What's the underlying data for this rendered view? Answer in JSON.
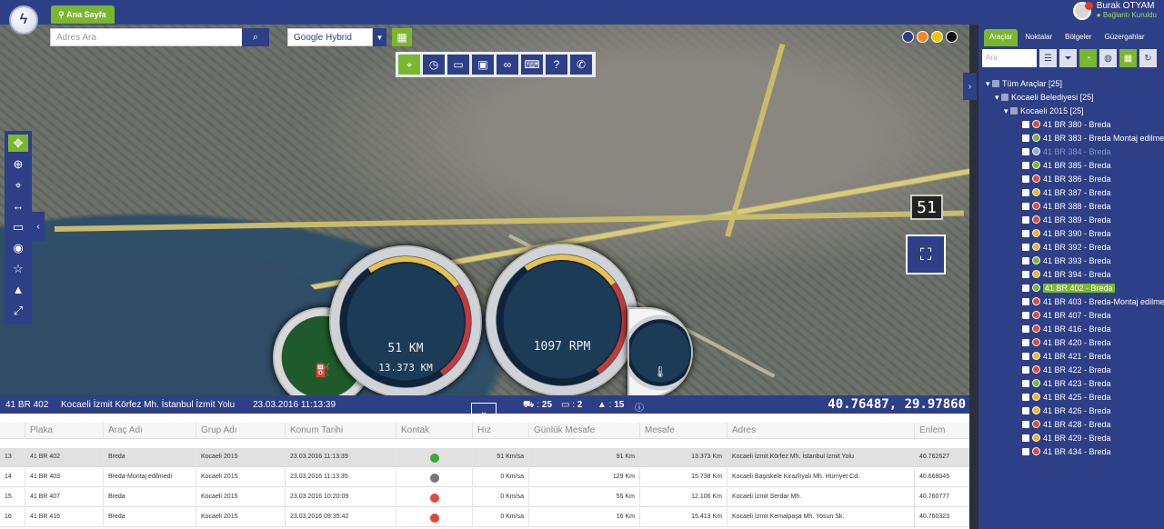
{
  "header": {
    "home_tab": "Ana Sayfa",
    "user_name": "Burak OTYAM",
    "user_status": "Bağlantı Kuruldu"
  },
  "map": {
    "search_placeholder": "Adres Ara",
    "map_type": "Google Hybrid",
    "color_dots": [
      "#2d3f86",
      "#f0882a",
      "#f2c300",
      "#111111"
    ],
    "speed_limit": "51",
    "gauges": {
      "speed_value": "51 KM",
      "odometer": "13.373 KM",
      "rpm_value": "1097 RPM"
    }
  },
  "status_bar": {
    "plate": "41 BR 402",
    "address": "Kocaeli İzmit Körfez Mh. İstanbul İzmit Yolu",
    "datetime": "23.03.2016 11:13:39",
    "vehicles": "25",
    "screens": "2",
    "roads": "15",
    "coordinates": "40.76487, 29.97860"
  },
  "table": {
    "headers": [
      "Plaka",
      "Araç Adı",
      "Grup Adı",
      "Konum Tarihi",
      "Kontak",
      "Hız",
      "Günlük Mesafe",
      "Mesafe",
      "Adres",
      "Enlem"
    ],
    "rows": [
      {
        "no": "13",
        "plate": "41 BR 402",
        "name": "Breda",
        "group": "Kocaeli 2015",
        "date": "23.03.2016 11:13:39",
        "kontak": "green",
        "speed": "51 Km/sa",
        "daily": "91 Km",
        "dist": "13.373 Km",
        "addr": "Kocaeli İzmit Körfez Mh. İstanbul İzmit Yolu",
        "lat": "40.762627"
      },
      {
        "no": "14",
        "plate": "41 BR 403",
        "name": "Breda-Montaj edilmedi",
        "group": "Kocaeli 2015",
        "date": "23.03.2016 11:13:35",
        "kontak": "grey",
        "speed": "0 Km/sa",
        "daily": "129 Km",
        "dist": "15.738 Km",
        "addr": "Kocaeli Başiskele Kirazlıyalı Mh. Hürriyet Cd.",
        "lat": "40.668045"
      },
      {
        "no": "15",
        "plate": "41 BR 407",
        "name": "Breda",
        "group": "Kocaeli 2015",
        "date": "23.03.2016 10:20:09",
        "kontak": "red",
        "speed": "0 Km/sa",
        "daily": "55 Km",
        "dist": "12.106 Km",
        "addr": "Kocaeli İzmit Serdar Mh.",
        "lat": "40.760777"
      },
      {
        "no": "16",
        "plate": "41 BR 416",
        "name": "Breda",
        "group": "Kocaeli 2015",
        "date": "23.03.2016 09:35:42",
        "kontak": "red",
        "speed": "0 Km/sa",
        "daily": "16 Km",
        "dist": "15.413 Km",
        "addr": "Kocaeli İzmit Kemalpaşa Mh. Yosun Sk.",
        "lat": "40.760323"
      }
    ]
  },
  "sidebar": {
    "tabs": [
      "Araçlar",
      "Noktalar",
      "Bölgeler",
      "Güzergahlar"
    ],
    "search_placeholder": "Ara",
    "tree_root": "Tüm Araçlar [25]",
    "tree_group": "Kocaeli Belediyesi [25]",
    "tree_subgroup": "Kocaeli 2015 [25]",
    "vehicles": [
      {
        "label": "41 BR 380 - Breda",
        "color": "#e04a3a"
      },
      {
        "label": "41 BR 383 - Breda Montaj edilmedi",
        "color": "#7bb62f"
      },
      {
        "label": "41 BR 384 - Breda",
        "color": "#9aa6c8"
      },
      {
        "label": "41 BR 385 - Breda",
        "color": "#7bb62f"
      },
      {
        "label": "41 BR 386 - Breda",
        "color": "#e04a3a"
      },
      {
        "label": "41 BR 387 - Breda",
        "color": "#f0b429"
      },
      {
        "label": "41 BR 388 - Breda",
        "color": "#e04a3a"
      },
      {
        "label": "41 BR 389 - Breda",
        "color": "#e04a3a"
      },
      {
        "label": "41 BR 390 - Breda",
        "color": "#f0b429"
      },
      {
        "label": "41 BR 392 - Breda",
        "color": "#f0b429"
      },
      {
        "label": "41 BR 393 - Breda",
        "color": "#7bb62f"
      },
      {
        "label": "41 BR 394 - Breda",
        "color": "#f0b429"
      },
      {
        "label": "41 BR 402 - Breda",
        "color": "#7bb62f"
      },
      {
        "label": "41 BR 403 - Breda-Montaj edilmedi",
        "color": "#e04a3a"
      },
      {
        "label": "41 BR 407 - Breda",
        "color": "#e04a3a"
      },
      {
        "label": "41 BR 416 - Breda",
        "color": "#e04a3a"
      },
      {
        "label": "41 BR 420 - Breda",
        "color": "#e04a3a"
      },
      {
        "label": "41 BR 421 - Breda",
        "color": "#f0b429"
      },
      {
        "label": "41 BR 422 - Breda",
        "color": "#e04a3a"
      },
      {
        "label": "41 BR 423 - Breda",
        "color": "#7bb62f"
      },
      {
        "label": "41 BR 425 - Breda",
        "color": "#f0b429"
      },
      {
        "label": "41 BR 426 - Breda",
        "color": "#f0b429"
      },
      {
        "label": "41 BR 428 - Breda",
        "color": "#e04a3a"
      },
      {
        "label": "41 BR 429 - Breda",
        "color": "#f0b429"
      },
      {
        "label": "41 BR 434 - Breda",
        "color": "#e04a3a"
      }
    ]
  }
}
